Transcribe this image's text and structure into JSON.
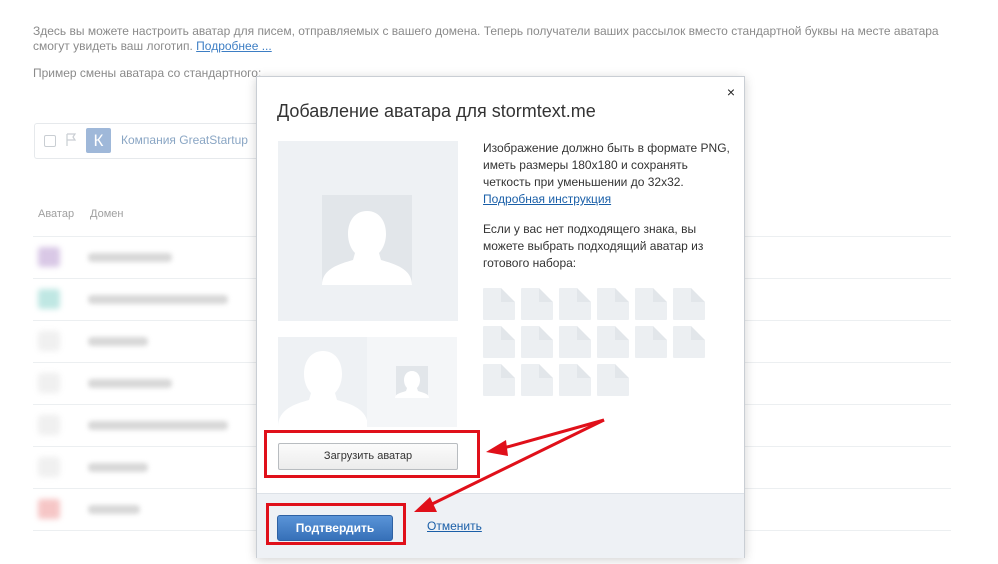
{
  "page": {
    "intro_text": "Здесь вы можете настроить аватар для писем, отправляемых с вашего домена. Теперь получатели ваших рассылок вместо стандартной буквы на месте аватара смогут увидеть ваш логотип.",
    "intro_link": "Подробнее ...",
    "example_text": "Пример смены аватара со стандартного:",
    "preview_letter": "К",
    "preview_company": "Компания GreatStartup",
    "table_headers": {
      "avatar": "Аватар",
      "domain": "Домен"
    },
    "row_icon_colors": [
      "#d9c8e6",
      "#bfe7e3",
      "#f0f0f0",
      "#f0f0f0",
      "#f0f0f0",
      "#f0f0f0",
      "#f6c6c6"
    ]
  },
  "modal": {
    "title": "Добавление аватара для stormtext.me",
    "close_symbol": "×",
    "requirements": "Изображение должно быть в формате PNG, иметь размеры 180x180 и сохранять четкость при уменьшении до 32x32.",
    "instructions_link": "Подробная инструкция",
    "choose_text": "Если у вас нет подходящего знака, вы можете выбрать подходящий аватар из готового набора:",
    "preset_tiles": 16,
    "upload_button": "Загрузить аватар",
    "confirm_button": "Подтвердить",
    "cancel_link": "Отменить"
  },
  "colors": {
    "accent": "#3670b8",
    "link": "#1a5fa8",
    "highlight": "#e0101a"
  }
}
